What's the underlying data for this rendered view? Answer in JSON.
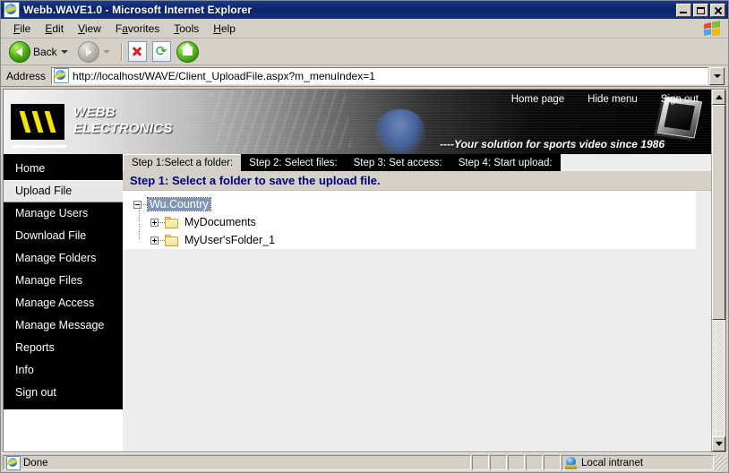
{
  "window": {
    "title": "Webb.WAVE1.0 - Microsoft Internet Explorer",
    "icon": "ie-document-icon",
    "buttons": {
      "minimize": "_",
      "maximize": "□",
      "close": "✕"
    }
  },
  "menubar": {
    "items": [
      {
        "label": "File",
        "accel": "F"
      },
      {
        "label": "Edit",
        "accel": "E"
      },
      {
        "label": "View",
        "accel": "V"
      },
      {
        "label": "Favorites",
        "accel": "a"
      },
      {
        "label": "Tools",
        "accel": "T"
      },
      {
        "label": "Help",
        "accel": "H"
      }
    ],
    "brand_icon": "windows-flag-icon"
  },
  "toolbar": {
    "back_label": "Back",
    "back_icon": "back-arrow-icon",
    "forward_icon": "forward-arrow-icon",
    "stop_icon": "stop-icon",
    "refresh_icon": "refresh-icon",
    "home_icon": "home-icon"
  },
  "address": {
    "label": "Address",
    "icon": "page-icon",
    "url": "http://localhost/WAVE/Client_UploadFile.aspx?m_menuIndex=1",
    "dropdown_icon": "chevron-down-icon"
  },
  "banner": {
    "logo_icon": "webb-chevrons-logo",
    "logo_line1": "WEBB",
    "logo_line2": "ELECTRONICS",
    "tagline": "----Your solution for sports video since 1986",
    "nav": [
      {
        "label": "Home page"
      },
      {
        "label": "Hide menu"
      },
      {
        "label": "Sign out"
      }
    ],
    "accent_yellow": "#f2e205"
  },
  "sidebar": {
    "items": [
      {
        "label": "Home",
        "active": false
      },
      {
        "label": "Upload File",
        "active": true
      },
      {
        "label": "Manage Users",
        "active": false
      },
      {
        "label": "Download File",
        "active": false
      },
      {
        "label": "Manage Folders",
        "active": false
      },
      {
        "label": "Manage Files",
        "active": false
      },
      {
        "label": "Manage Access",
        "active": false
      },
      {
        "label": "Manage Message",
        "active": false
      },
      {
        "label": "Reports",
        "active": false
      },
      {
        "label": "Info",
        "active": false
      },
      {
        "label": "Sign out",
        "active": false
      }
    ]
  },
  "main": {
    "steps": [
      {
        "label": "Step 1:Select a folder:",
        "active": true
      },
      {
        "label": "Step 2: Select files:",
        "active": false
      },
      {
        "label": "Step 3: Set access:",
        "active": false
      },
      {
        "label": "Step 4: Start upload:",
        "active": false
      }
    ],
    "heading": "Step 1: Select a folder to save the upload file.",
    "heading_color": "#000080",
    "tree": {
      "root": {
        "label": "Wu.Country",
        "expander": "minus",
        "selected": true
      },
      "children": [
        {
          "label": "MyDocuments",
          "expander": "plus",
          "icon": "folder-icon"
        },
        {
          "label": "MyUser'sFolder_1",
          "expander": "plus",
          "icon": "folder-icon"
        }
      ]
    }
  },
  "statusbar": {
    "message": "Done",
    "message_icon": "page-icon",
    "zone": "Local intranet",
    "zone_icon": "globe-icon"
  }
}
